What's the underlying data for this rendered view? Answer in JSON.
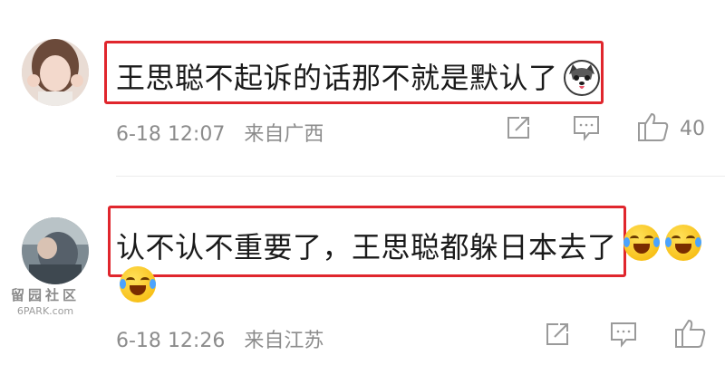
{
  "comments": [
    {
      "text": "王思聪不起诉的话那不就是默认了",
      "emoji": "husky-emoji",
      "date": "6-18",
      "time": "12:07",
      "source": "来自广西",
      "like_count": "40"
    },
    {
      "text": "认不认不重要了，王思聪都躲日本去了",
      "emoji": "laughing-crying-emoji",
      "date": "6-18",
      "time": "12:26",
      "source": "来自江苏",
      "like_count": ""
    }
  ],
  "icons": {
    "share": "share-icon",
    "comment": "comment-icon",
    "like": "thumbs-up-icon"
  },
  "watermark": {
    "hanzi": "留园社区",
    "latin": "6PARK.com"
  },
  "colors": {
    "highlight_border": "#e0262d",
    "meta_text": "#8c8c8c",
    "comment_text": "#1a1a1a"
  }
}
